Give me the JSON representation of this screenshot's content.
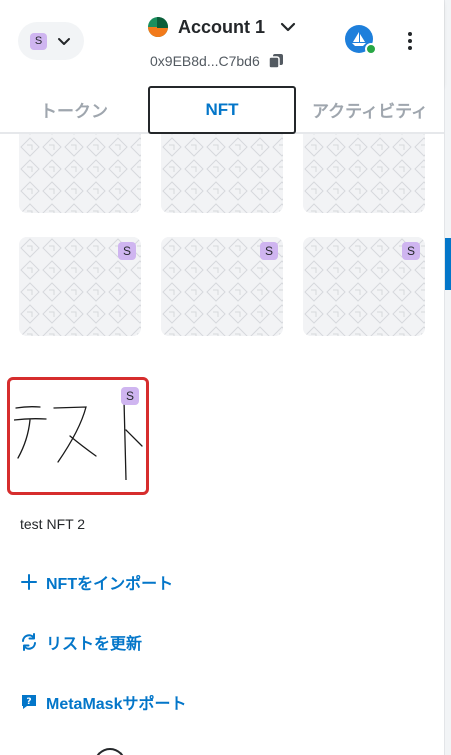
{
  "header": {
    "network_badge": "S",
    "account_name": "Account 1",
    "address": "0x9EB8d...C7bd6"
  },
  "tabs": [
    {
      "label": "トークン",
      "active": false
    },
    {
      "label": "NFT",
      "active": true
    },
    {
      "label": "アクティビティ",
      "active": false
    }
  ],
  "nfts": {
    "badge": "S",
    "selected_title": "test NFT 2"
  },
  "actions": {
    "import_nft": "NFTをインポート",
    "refresh_list": "リストを更新",
    "support": "MetaMaskサポート"
  },
  "colors": {
    "accent": "#0376c9",
    "badge_bg": "#cfb5f0",
    "selection_border": "#d62d2d"
  }
}
